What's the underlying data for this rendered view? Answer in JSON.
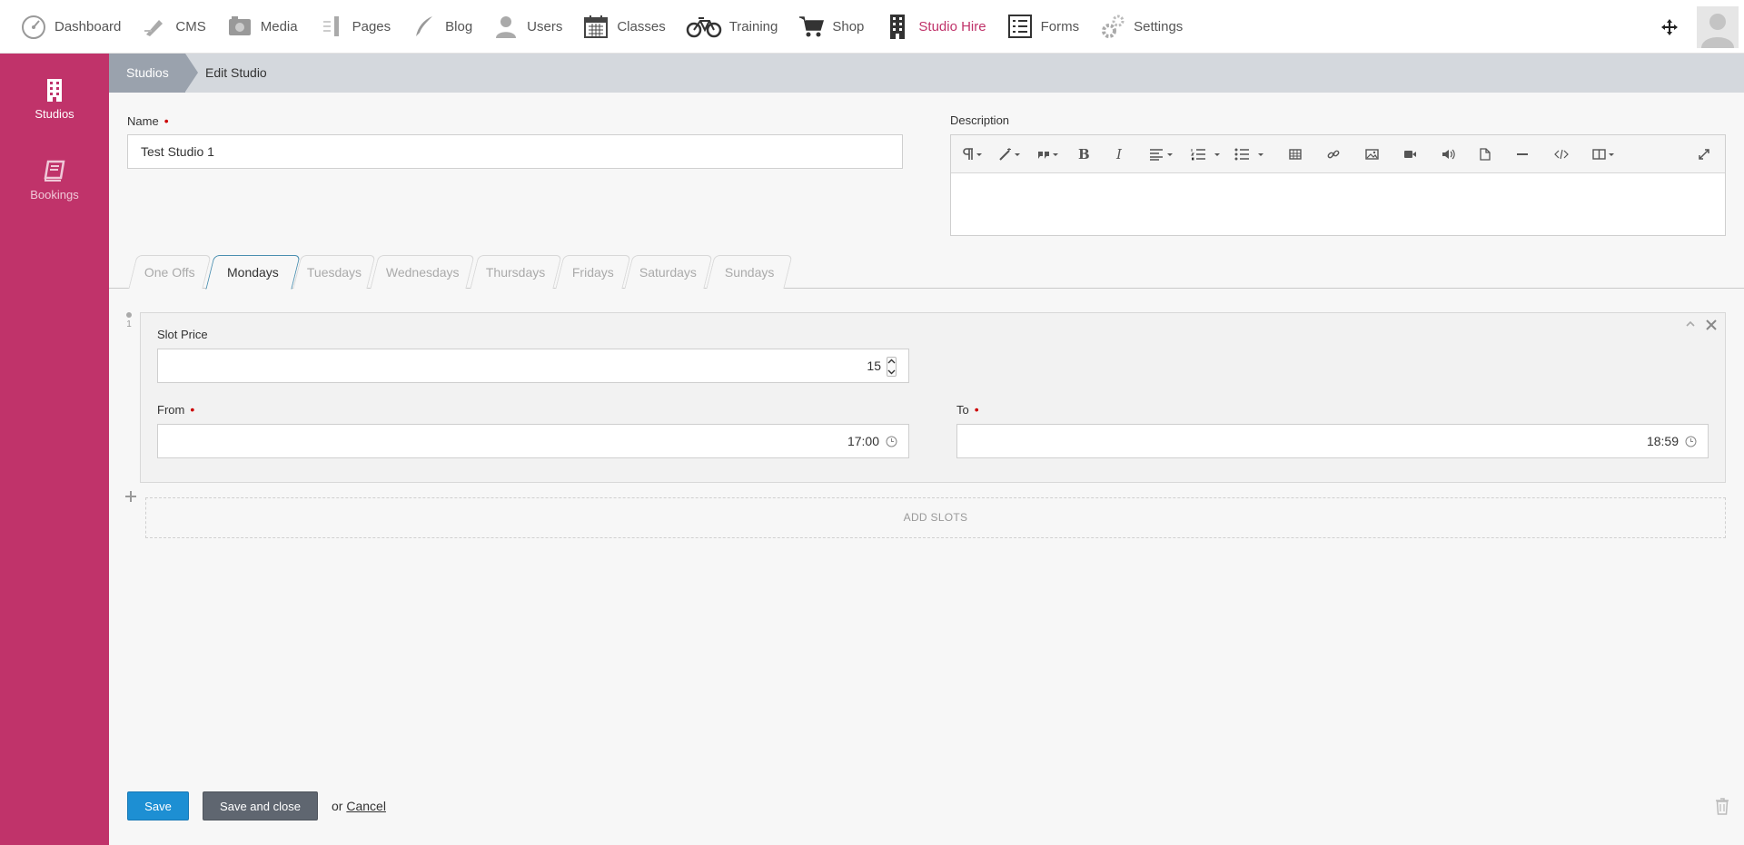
{
  "topnav": {
    "items": [
      {
        "label": "Dashboard",
        "icon": "dashboard-icon"
      },
      {
        "label": "CMS",
        "icon": "pencil-icon"
      },
      {
        "label": "Media",
        "icon": "camera-icon"
      },
      {
        "label": "Pages",
        "icon": "pages-icon"
      },
      {
        "label": "Blog",
        "icon": "quill-icon"
      },
      {
        "label": "Users",
        "icon": "user-icon"
      },
      {
        "label": "Classes",
        "icon": "calendar-icon"
      },
      {
        "label": "Training",
        "icon": "bicycle-icon"
      },
      {
        "label": "Shop",
        "icon": "cart-icon"
      },
      {
        "label": "Studio Hire",
        "icon": "building-icon"
      },
      {
        "label": "Forms",
        "icon": "form-icon"
      },
      {
        "label": "Settings",
        "icon": "gears-icon"
      }
    ],
    "active": "Studio Hire"
  },
  "sidebar": {
    "items": [
      {
        "label": "Studios",
        "icon": "building-icon"
      },
      {
        "label": "Bookings",
        "icon": "book-icon"
      }
    ]
  },
  "breadcrumb": {
    "parent": "Studios",
    "current": "Edit Studio"
  },
  "form": {
    "name_label": "Name",
    "name_value": "Test Studio 1",
    "description_label": "Description",
    "required_mark": "•"
  },
  "tabs": [
    "One Offs",
    "Mondays",
    "Tuesdays",
    "Wednesdays",
    "Thursdays",
    "Fridays",
    "Saturdays",
    "Sundays"
  ],
  "active_tab": "Mondays",
  "slot": {
    "index": "1",
    "price_label": "Slot Price",
    "price_value": "15",
    "from_label": "From",
    "from_value": "17:00",
    "to_label": "To",
    "to_value": "18:59"
  },
  "add_slots_label": "ADD SLOTS",
  "actions": {
    "save": "Save",
    "save_close": "Save and close",
    "or": "or",
    "cancel": "Cancel"
  },
  "colors": {
    "brand": "#c0336a",
    "primary_button": "#1d8fd3",
    "secondary_button": "#5f6670"
  }
}
